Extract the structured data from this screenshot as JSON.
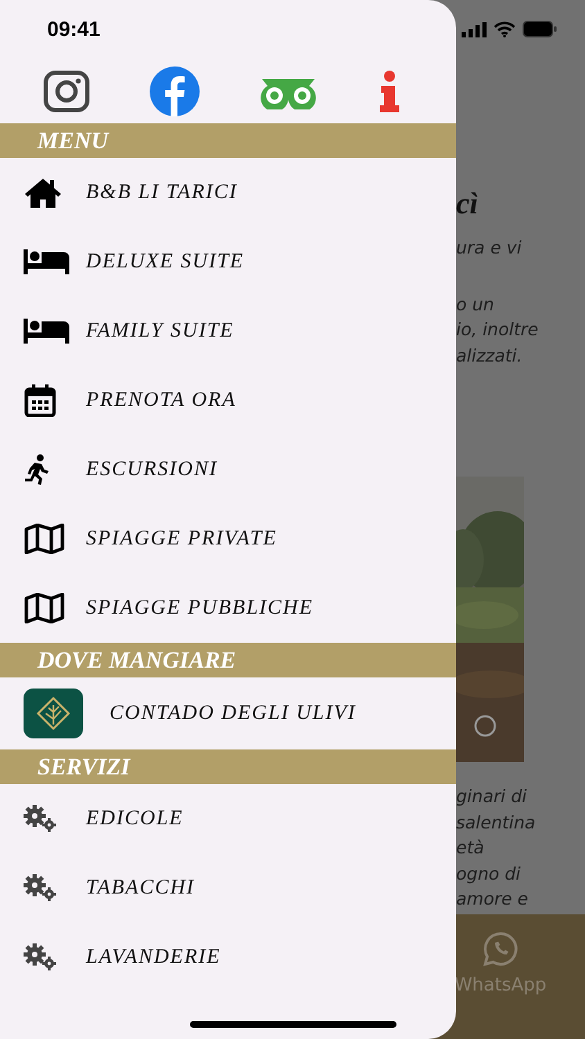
{
  "status_bar": {
    "time": "09:41"
  },
  "menu_sections": [
    {
      "title": "MENU",
      "items": [
        {
          "label": "B&B LI TARICI",
          "kind": "home"
        },
        {
          "label": "DELUXE SUITE",
          "kind": "bed"
        },
        {
          "label": "FAMILY SUITE",
          "kind": "bed"
        },
        {
          "label": "PRENOTA ORA",
          "kind": "calendar"
        },
        {
          "label": "ESCURSIONI",
          "kind": "run"
        },
        {
          "label": "SPIAGGE PRIVATE",
          "kind": "map"
        },
        {
          "label": "SPIAGGE PUBBLICHE",
          "kind": "map"
        }
      ]
    },
    {
      "title": "DOVE MANGIARE",
      "items": [
        {
          "label": "CONTADO DEGLI ULIVI",
          "kind": "logo"
        }
      ]
    },
    {
      "title": "SERVIZI",
      "items": [
        {
          "label": "EDICOLE",
          "kind": "gears"
        },
        {
          "label": "TABACCHI",
          "kind": "gears"
        },
        {
          "label": "LAVANDERIE",
          "kind": "gears"
        }
      ]
    }
  ],
  "background_page": {
    "heading": "cì",
    "intro_lines": [
      "ura e vi"
    ],
    "text_lines": [
      "o un",
      "io, inoltre",
      "alizzati."
    ],
    "lower_lines": [
      "ginari di",
      "salentina",
      "età",
      "ogno di",
      "amore e"
    ],
    "bottom_bar": {
      "label": "WhatsApp"
    }
  }
}
